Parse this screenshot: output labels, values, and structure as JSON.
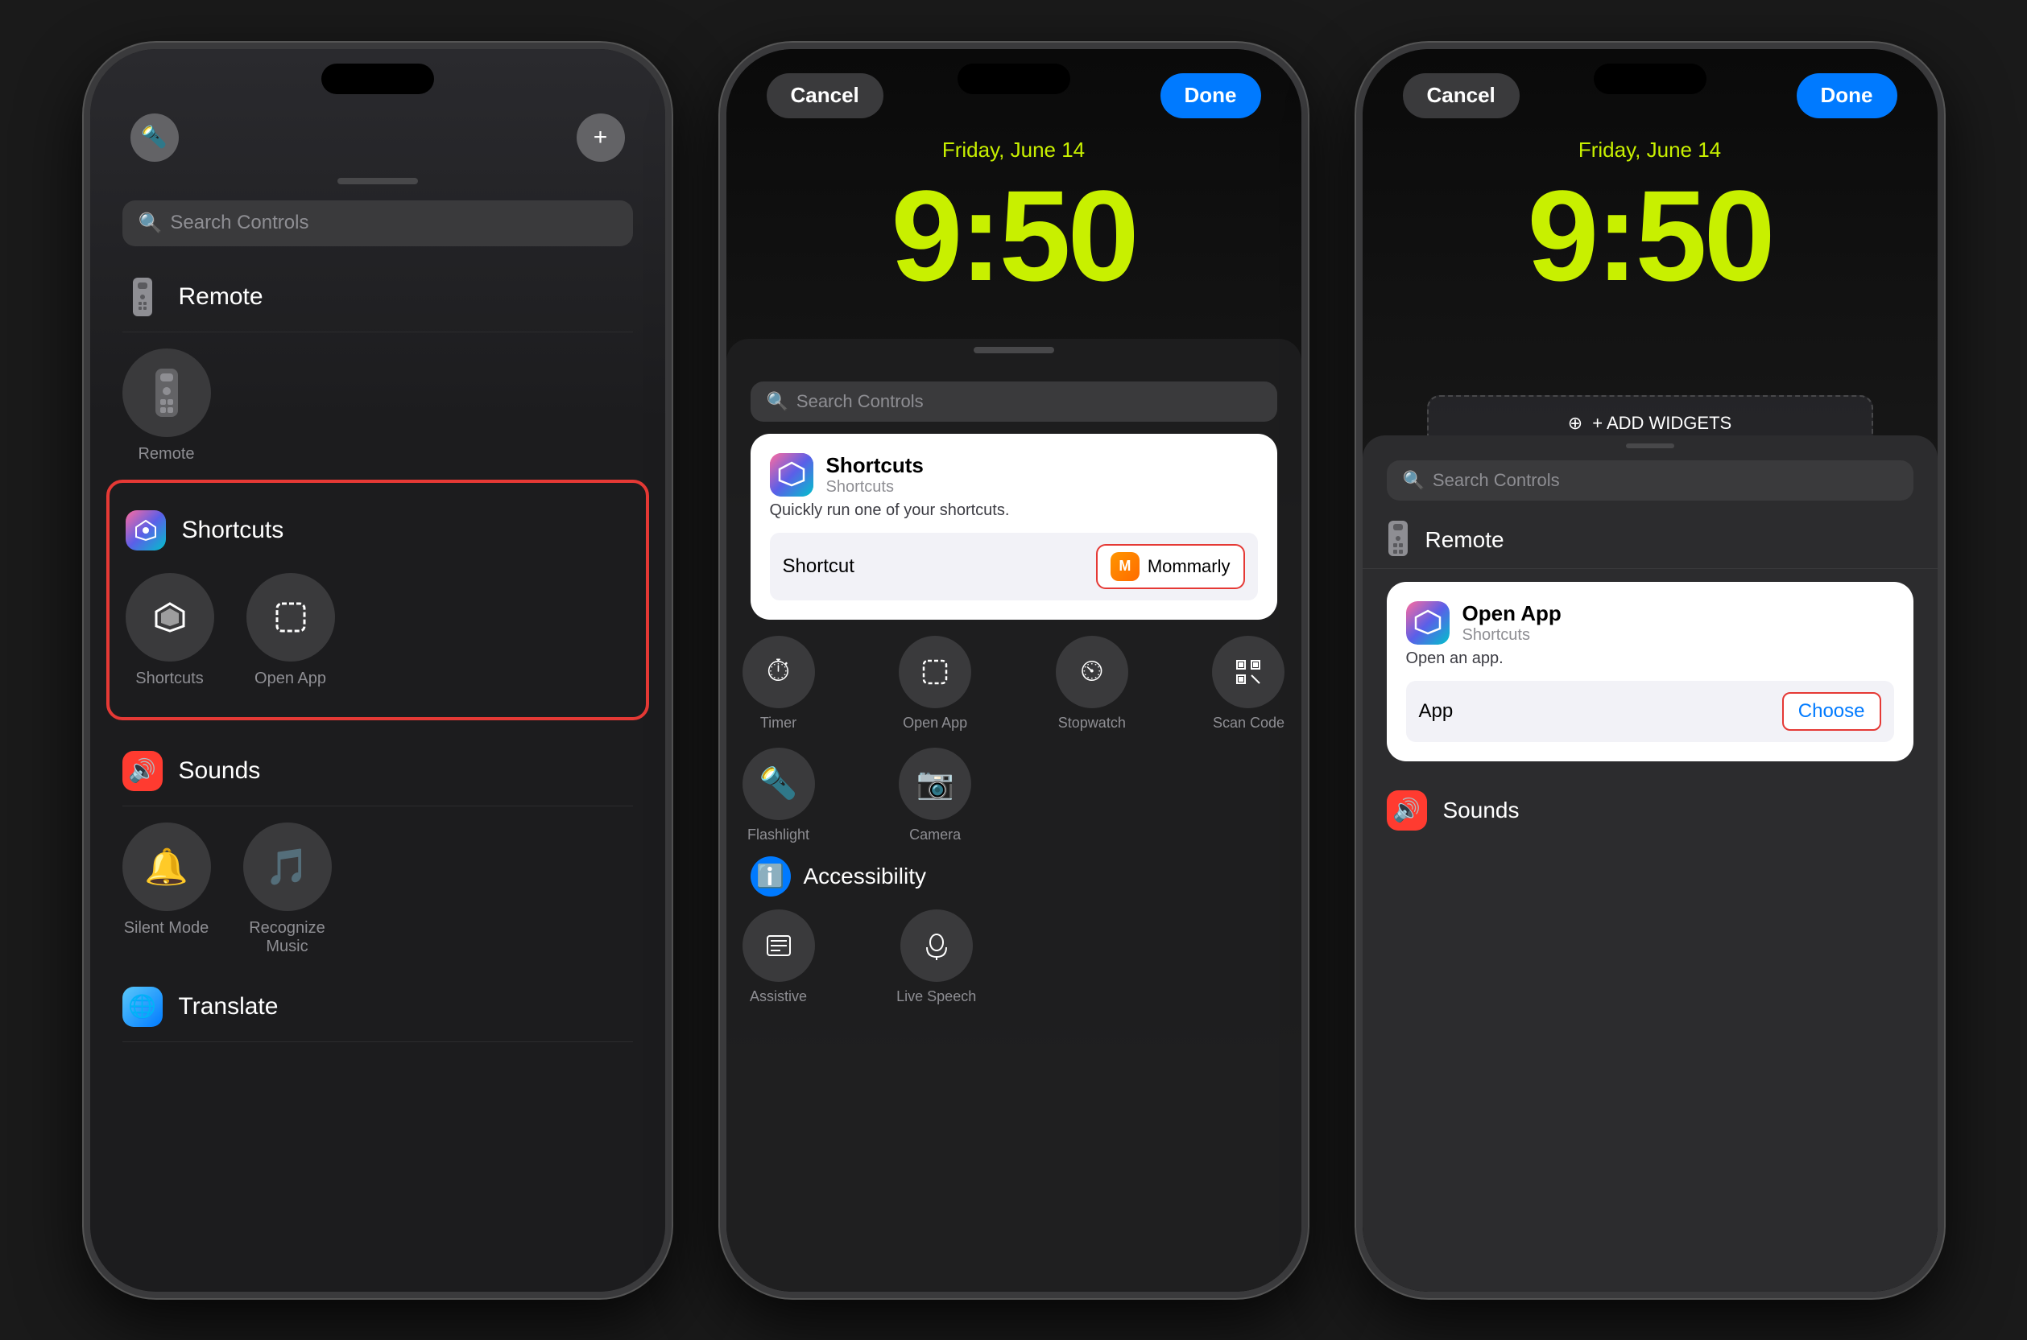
{
  "colors": {
    "accent_yellow": "#c8f000",
    "accent_blue": "#007aff",
    "red_border": "#e53935",
    "dark_bg": "#1c1c1e",
    "card_bg": "#ffffff",
    "search_bg": "#3a3a3c",
    "text_secondary": "#8e8e93"
  },
  "phone1": {
    "section_remote_label": "Remote",
    "section_shortcuts_label": "Shortcuts",
    "section_sounds_label": "Sounds",
    "section_translate_label": "Translate",
    "search_placeholder": "Search Controls",
    "control_shortcuts_label": "Shortcuts",
    "control_open_app_label": "Open App",
    "control_silent_label": "Silent Mode",
    "control_recognize_label": "Recognize Music"
  },
  "phone2": {
    "cancel_label": "Cancel",
    "done_label": "Done",
    "date_label": "Friday, June 14",
    "time_label": "9:50",
    "search_placeholder": "Search Controls",
    "shortcuts_card_title": "Shortcuts",
    "shortcuts_card_subtitle": "Shortcuts",
    "shortcuts_card_desc": "Quickly run one of your shortcuts.",
    "shortcut_field_label": "Shortcut",
    "mommarly_label": "Mommarly",
    "timer_label": "Timer",
    "open_app_label": "Open App",
    "stopwatch_label": "Stopwatch",
    "scan_code_label": "Scan Code",
    "flashlight_label": "Flashlight",
    "camera_label": "Camera",
    "accessibility_label": "Accessibility",
    "assistive_label": "Assistive",
    "live_speech_label": "Live Speech"
  },
  "phone3": {
    "cancel_label": "Cancel",
    "done_label": "Done",
    "date_label": "Friday, June 14",
    "time_label": "9:50",
    "add_widgets_label": "+ ADD WIDGETS",
    "search_placeholder": "Search Controls",
    "remote_label": "Remote",
    "open_app_card_title": "Open App",
    "open_app_card_subtitle": "Shortcuts",
    "open_app_card_desc": "Open an app.",
    "app_field_label": "App",
    "choose_label": "Choose",
    "sounds_label": "Sounds"
  }
}
